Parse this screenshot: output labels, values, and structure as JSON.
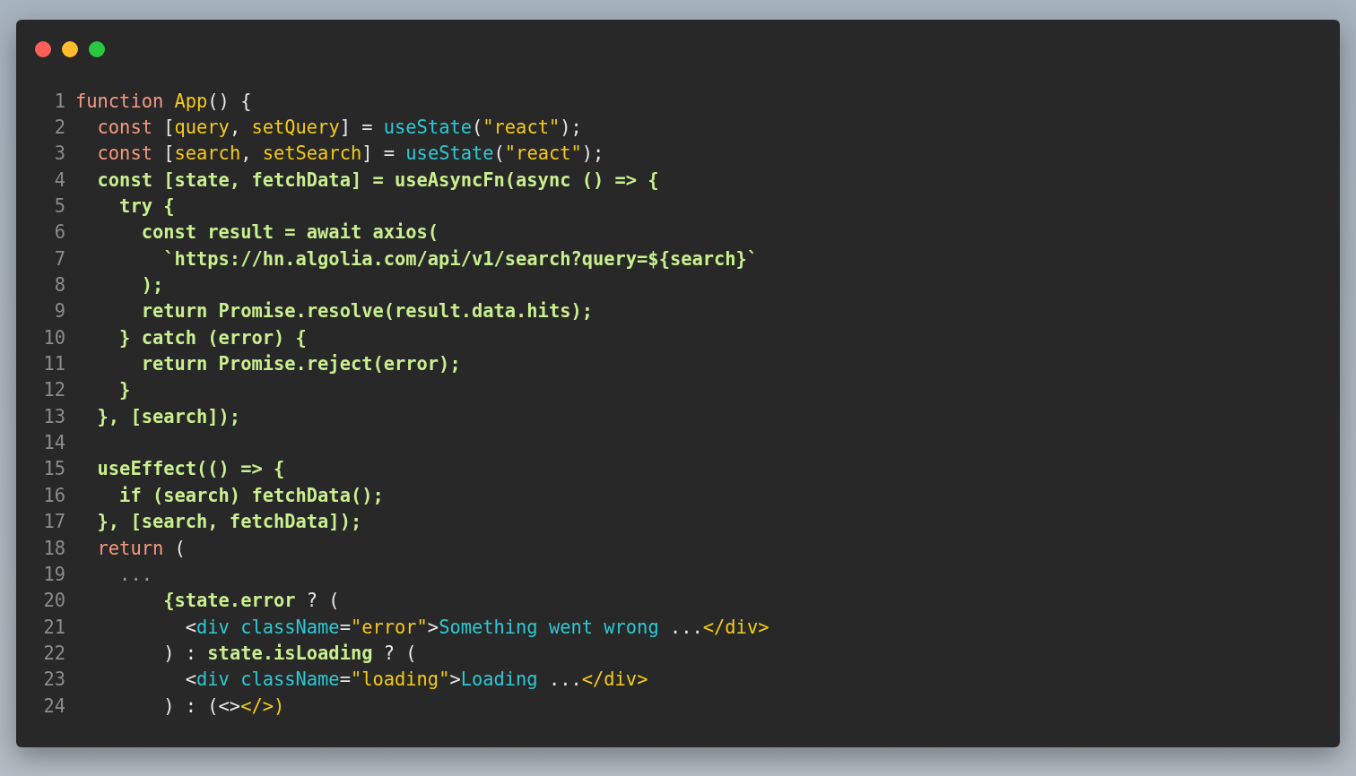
{
  "window": {
    "controls": [
      {
        "kind": "close"
      },
      {
        "kind": "minimize"
      },
      {
        "kind": "maximize"
      }
    ]
  },
  "lines": [
    {
      "number": "1",
      "tokens": [
        {
          "kind": "kw",
          "text": "function "
        },
        {
          "kind": "var",
          "text": "App"
        },
        {
          "kind": "plain",
          "text": "() {"
        }
      ]
    },
    {
      "number": "2",
      "tokens": [
        {
          "kind": "kw",
          "text": "  const "
        },
        {
          "kind": "plain",
          "text": "["
        },
        {
          "kind": "var",
          "text": "query"
        },
        {
          "kind": "plain",
          "text": ", "
        },
        {
          "kind": "var",
          "text": "setQuery"
        },
        {
          "kind": "plain",
          "text": "] = "
        },
        {
          "kind": "fn",
          "text": "useState"
        },
        {
          "kind": "plain",
          "text": "("
        },
        {
          "kind": "str",
          "text": "\"react\""
        },
        {
          "kind": "plain",
          "text": ");"
        }
      ]
    },
    {
      "number": "3",
      "tokens": [
        {
          "kind": "kw",
          "text": "  const "
        },
        {
          "kind": "plain",
          "text": "["
        },
        {
          "kind": "var",
          "text": "search"
        },
        {
          "kind": "plain",
          "text": ", "
        },
        {
          "kind": "var",
          "text": "setSearch"
        },
        {
          "kind": "plain",
          "text": "] = "
        },
        {
          "kind": "fn",
          "text": "useState"
        },
        {
          "kind": "plain",
          "text": "("
        },
        {
          "kind": "str",
          "text": "\"react\""
        },
        {
          "kind": "plain",
          "text": ");"
        }
      ]
    },
    {
      "number": "4",
      "tokens": [
        {
          "kind": "hl",
          "text": "  const [state, fetchData] = useAsyncFn(async () => {"
        }
      ]
    },
    {
      "number": "5",
      "tokens": [
        {
          "kind": "hl",
          "text": "    try {"
        }
      ]
    },
    {
      "number": "6",
      "tokens": [
        {
          "kind": "hl",
          "text": "      const result = await axios("
        }
      ]
    },
    {
      "number": "7",
      "tokens": [
        {
          "kind": "hl",
          "text": "        `https://hn.algolia.com/api/v1/search?query=${search}`"
        }
      ]
    },
    {
      "number": "8",
      "tokens": [
        {
          "kind": "hl",
          "text": "      );"
        }
      ]
    },
    {
      "number": "9",
      "tokens": [
        {
          "kind": "hl",
          "text": "      return Promise.resolve(result.data.hits);"
        }
      ]
    },
    {
      "number": "10",
      "tokens": [
        {
          "kind": "hl",
          "text": "    } catch (error) {"
        }
      ]
    },
    {
      "number": "11",
      "tokens": [
        {
          "kind": "hl",
          "text": "      return Promise.reject(error);"
        }
      ]
    },
    {
      "number": "12",
      "tokens": [
        {
          "kind": "hl",
          "text": "    }"
        }
      ]
    },
    {
      "number": "13",
      "tokens": [
        {
          "kind": "hl",
          "text": "  }, [search]);"
        }
      ]
    },
    {
      "number": "14"
    },
    {
      "number": "15",
      "tokens": [
        {
          "kind": "hl",
          "text": "  useEffect(() => {"
        }
      ]
    },
    {
      "number": "16",
      "tokens": [
        {
          "kind": "hl",
          "text": "    if (search) fetchData();"
        }
      ]
    },
    {
      "number": "17",
      "tokens": [
        {
          "kind": "hl",
          "text": "  }, [search, fetchData]);"
        }
      ]
    },
    {
      "number": "18",
      "tokens": [
        {
          "kind": "kw",
          "text": "  return "
        },
        {
          "kind": "plain",
          "text": "("
        }
      ]
    },
    {
      "number": "19",
      "tokens": [
        {
          "kind": "dim",
          "text": "    ..."
        }
      ]
    },
    {
      "number": "20",
      "tokens": [
        {
          "kind": "hl",
          "text": "        {state.error"
        },
        {
          "kind": "plain",
          "text": " ? ("
        }
      ]
    },
    {
      "number": "21",
      "tokens": [
        {
          "kind": "plain",
          "text": "          <"
        },
        {
          "kind": "fn",
          "text": "div className"
        },
        {
          "kind": "plain",
          "text": "="
        },
        {
          "kind": "str",
          "text": "\"error\""
        },
        {
          "kind": "plain",
          "text": ">"
        },
        {
          "kind": "fn",
          "text": "Something went wrong"
        },
        {
          "kind": "plain",
          "text": " ..."
        },
        {
          "kind": "str",
          "text": "</div>"
        }
      ]
    },
    {
      "number": "22",
      "tokens": [
        {
          "kind": "plain",
          "text": "        ) : "
        },
        {
          "kind": "hl",
          "text": "state.isLoading"
        },
        {
          "kind": "plain",
          "text": " ? ("
        }
      ]
    },
    {
      "number": "23",
      "tokens": [
        {
          "kind": "plain",
          "text": "          <"
        },
        {
          "kind": "fn",
          "text": "div className"
        },
        {
          "kind": "plain",
          "text": "="
        },
        {
          "kind": "str",
          "text": "\"loading\""
        },
        {
          "kind": "plain",
          "text": ">"
        },
        {
          "kind": "fn",
          "text": "Loading"
        },
        {
          "kind": "plain",
          "text": " ..."
        },
        {
          "kind": "str",
          "text": "</div>"
        }
      ]
    },
    {
      "number": "24",
      "tokens": [
        {
          "kind": "plain",
          "text": "        ) : (<>"
        },
        {
          "kind": "str",
          "text": "</>)"
        }
      ]
    }
  ]
}
